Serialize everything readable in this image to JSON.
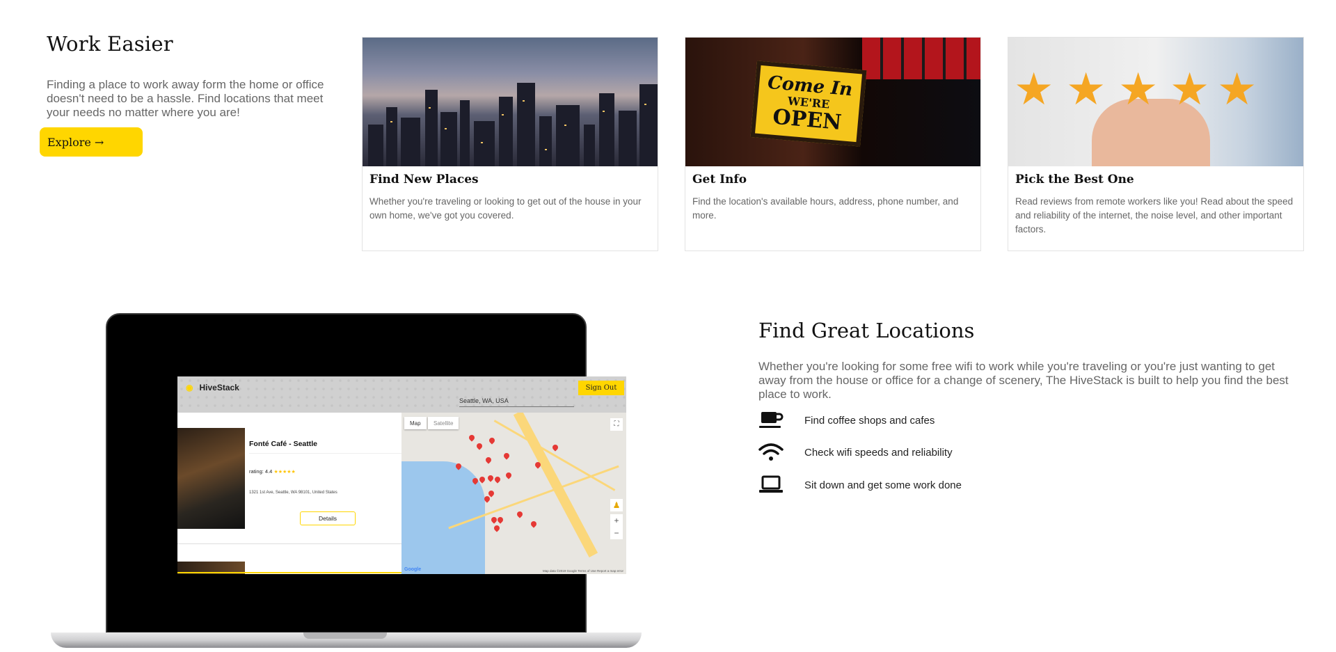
{
  "hero": {
    "title": "Work Easier",
    "text": "Finding a place to work away form the home or office doesn't need to be a hassle. Find locations that meet your needs no matter where you are!",
    "button": "Explore →"
  },
  "cards": [
    {
      "title": "Find New Places",
      "text": "Whether you're traveling or looking to get out of the house in your own home, we've got you covered.",
      "image": "city-skyline-night"
    },
    {
      "title": "Get Info",
      "text": "Find the location's available hours, address, phone number, and more.",
      "image": "open-sign"
    },
    {
      "title": "Pick the Best One",
      "text": "Read reviews from remote workers like you! Read about the speed and reliability of the internet, the noise level, and other important factors.",
      "image": "five-stars"
    }
  ],
  "open_sign": {
    "line1": "Come In",
    "line2": "WE'RE",
    "line3": "OPEN"
  },
  "app": {
    "name": "HiveStack",
    "sign_out": "Sign Out",
    "search_value": "Seattle, WA, USA",
    "listing": {
      "name": "Fonté Café - Seattle",
      "rating_label": "rating: 4.4",
      "stars": "★★★★★",
      "address": "1321 1st Ave, Seattle, WA 98101, United States",
      "details_button": "Details"
    },
    "map": {
      "tab_map": "Map",
      "tab_satellite": "Satellite",
      "zoom_in": "+",
      "zoom_out": "−",
      "google": "Google",
      "attribution": "Map data ©2019 Google   Terms of Use   Report a map error"
    }
  },
  "features": {
    "title": "Find Great Locations",
    "text": "Whether you're looking for some free wifi to work while you're traveling or you're just wanting to get away from the house or office for a change of scenery, The HiveStack is built to help you find the best place to work.",
    "items": [
      {
        "icon": "coffee-cup-icon",
        "label": "Find coffee shops and cafes"
      },
      {
        "icon": "wifi-icon",
        "label": "Check wifi speeds and reliability"
      },
      {
        "icon": "laptop-icon",
        "label": "Sit down and get some work done"
      }
    ]
  },
  "colors": {
    "accent": "#ffd600",
    "text": "#222222",
    "muted": "#666666"
  }
}
